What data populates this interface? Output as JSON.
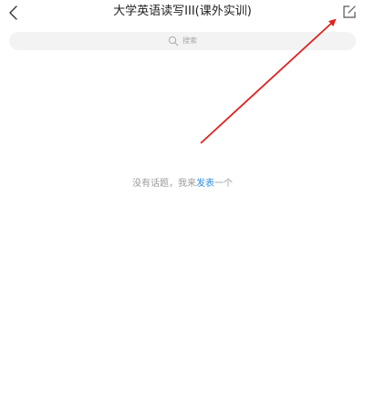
{
  "header": {
    "title": "大学英语读写III(课外实训)",
    "back_icon": "chevron-left-icon",
    "compose_icon": "compose-icon"
  },
  "search": {
    "placeholder": "搜索",
    "icon": "search-icon"
  },
  "empty_state": {
    "text_before": "没有话题，我来",
    "link": "发表",
    "text_after": "一个"
  },
  "colors": {
    "link": "#2f8de0",
    "annotation": "#e02020",
    "search_bg": "#f3f3f3"
  }
}
